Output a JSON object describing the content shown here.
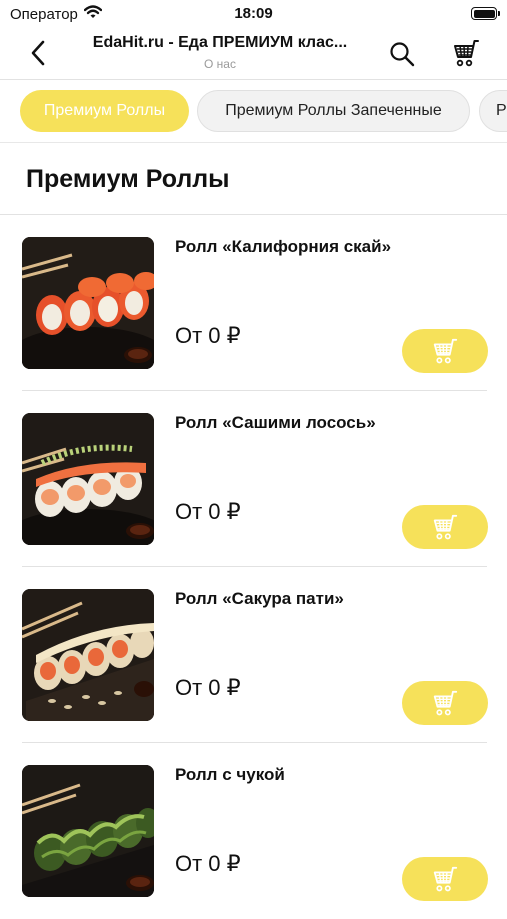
{
  "status_bar": {
    "carrier": "Оператор",
    "time": "18:09"
  },
  "nav": {
    "title": "EdaHit.ru - Еда ПРЕМИУМ клас...",
    "subtitle": "О нас"
  },
  "categories": [
    {
      "label": "Премиум Роллы",
      "active": true
    },
    {
      "label": "Премиум Роллы Запеченные",
      "active": false
    },
    {
      "label": "Р",
      "active": false
    }
  ],
  "section": {
    "title": "Премиум Роллы"
  },
  "products": [
    {
      "name": "Ролл «Калифорния скай»",
      "price": "От 0 ₽"
    },
    {
      "name": "Ролл «Сашими лосось»",
      "price": "От 0 ₽"
    },
    {
      "name": "Ролл «Сакура пати»",
      "price": "От 0 ₽"
    },
    {
      "name": "Ролл с чукой",
      "price": "От 0 ₽"
    }
  ],
  "colors": {
    "accent": "#f6e15a",
    "chip_inactive": "#f2f2f2",
    "divider": "#e2e2e2",
    "subtitle_gray": "#9a9a9a"
  },
  "icons": [
    "wifi-icon",
    "battery-icon",
    "chevron-left-icon",
    "search-icon",
    "cart-icon"
  ]
}
